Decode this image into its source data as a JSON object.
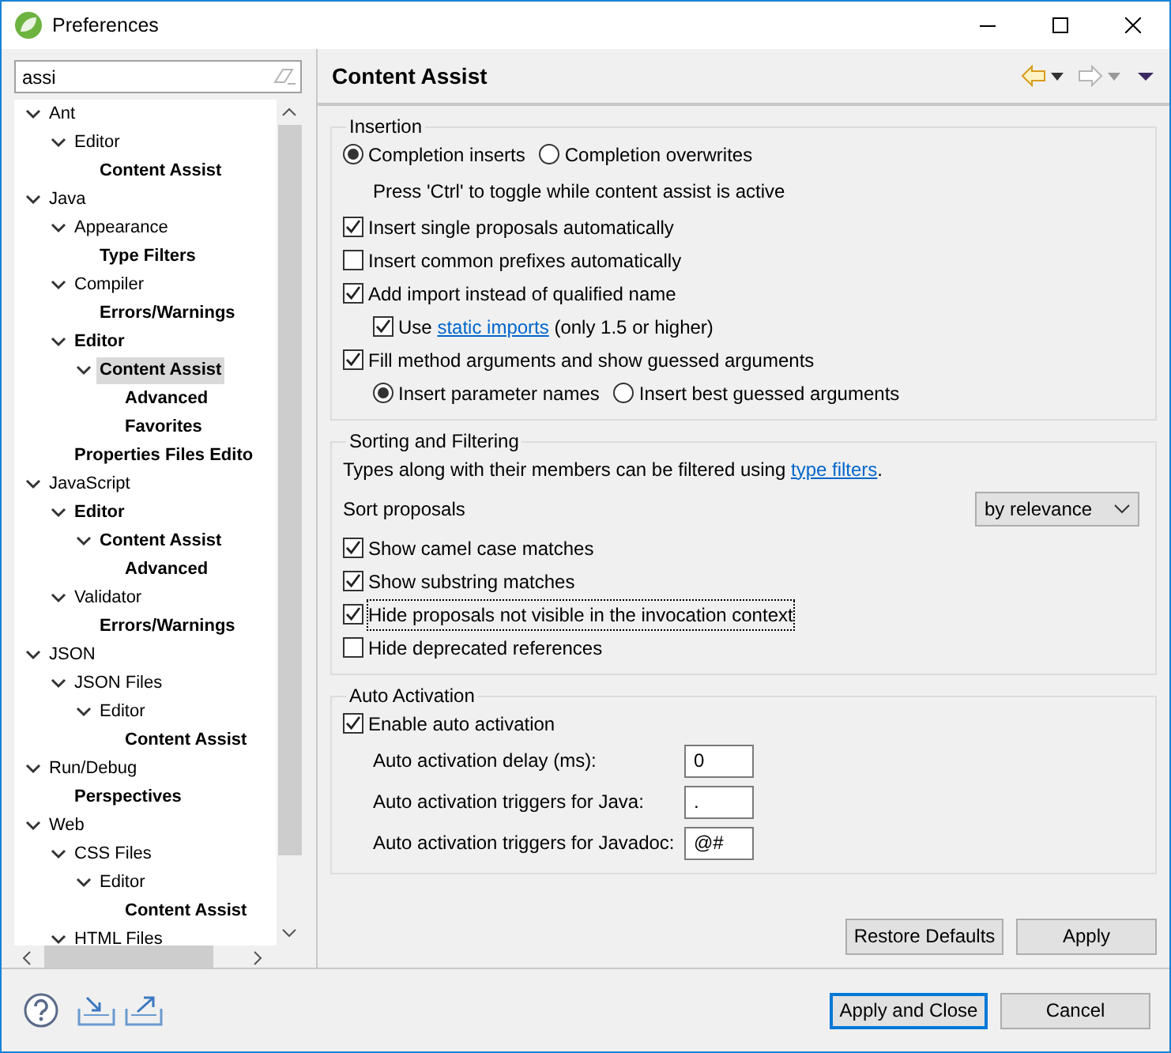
{
  "window": {
    "title": "Preferences"
  },
  "filter": {
    "value": "assi"
  },
  "tree": [
    {
      "label": "Ant",
      "bold": false,
      "expanded": true,
      "selected": false,
      "children": [
        {
          "label": "Editor",
          "bold": false,
          "expanded": true,
          "selected": false,
          "children": [
            {
              "label": "Content Assist",
              "bold": true,
              "selected": false
            }
          ]
        }
      ]
    },
    {
      "label": "Java",
      "bold": false,
      "expanded": true,
      "selected": false,
      "children": [
        {
          "label": "Appearance",
          "bold": false,
          "expanded": true,
          "selected": false,
          "children": [
            {
              "label": "Type Filters",
              "bold": true,
              "selected": false
            }
          ]
        },
        {
          "label": "Compiler",
          "bold": false,
          "expanded": true,
          "selected": false,
          "children": [
            {
              "label": "Errors/Warnings",
              "bold": true,
              "selected": false
            }
          ]
        },
        {
          "label": "Editor",
          "bold": true,
          "expanded": true,
          "selected": false,
          "children": [
            {
              "label": "Content Assist",
              "bold": true,
              "expanded": true,
              "selected": true,
              "children": [
                {
                  "label": "Advanced",
                  "bold": true,
                  "selected": false
                },
                {
                  "label": "Favorites",
                  "bold": true,
                  "selected": false
                }
              ]
            }
          ]
        },
        {
          "label": "Properties Files Edito",
          "bold": true,
          "selected": false
        }
      ]
    },
    {
      "label": "JavaScript",
      "bold": false,
      "expanded": true,
      "selected": false,
      "children": [
        {
          "label": "Editor",
          "bold": true,
          "expanded": true,
          "selected": false,
          "children": [
            {
              "label": "Content Assist",
              "bold": true,
              "expanded": true,
              "selected": false,
              "children": [
                {
                  "label": "Advanced",
                  "bold": true,
                  "selected": false
                }
              ]
            }
          ]
        },
        {
          "label": "Validator",
          "bold": false,
          "expanded": true,
          "selected": false,
          "children": [
            {
              "label": "Errors/Warnings",
              "bold": true,
              "selected": false
            }
          ]
        }
      ]
    },
    {
      "label": "JSON",
      "bold": false,
      "expanded": true,
      "selected": false,
      "children": [
        {
          "label": "JSON Files",
          "bold": false,
          "expanded": true,
          "selected": false,
          "children": [
            {
              "label": "Editor",
              "bold": false,
              "expanded": true,
              "selected": false,
              "children": [
                {
                  "label": "Content Assist",
                  "bold": true,
                  "selected": false
                }
              ]
            }
          ]
        }
      ]
    },
    {
      "label": "Run/Debug",
      "bold": false,
      "expanded": true,
      "selected": false,
      "children": [
        {
          "label": "Perspectives",
          "bold": true,
          "selected": false
        }
      ]
    },
    {
      "label": "Web",
      "bold": false,
      "expanded": true,
      "selected": false,
      "children": [
        {
          "label": "CSS Files",
          "bold": false,
          "expanded": true,
          "selected": false,
          "children": [
            {
              "label": "Editor",
              "bold": false,
              "expanded": true,
              "selected": false,
              "children": [
                {
                  "label": "Content Assist",
                  "bold": true,
                  "selected": false
                }
              ]
            }
          ]
        },
        {
          "label": "HTML Files",
          "bold": false,
          "expanded": true,
          "selected": false
        }
      ]
    }
  ],
  "page": {
    "title": "Content Assist"
  },
  "groups": [
    {
      "title": "Insertion",
      "items": [
        {
          "kind": "radios",
          "options": [
            {
              "label": "Completion inserts",
              "selected": true
            },
            {
              "label": "Completion overwrites",
              "selected": false
            }
          ]
        },
        {
          "kind": "note",
          "text": "Press 'Ctrl' to toggle while content assist is active"
        },
        {
          "kind": "checkbox",
          "label": "Insert single proposals automatically",
          "checked": true
        },
        {
          "kind": "checkbox",
          "label": "Insert common prefixes automatically",
          "checked": false
        },
        {
          "kind": "checkbox",
          "label": "Add import instead of qualified name",
          "checked": true,
          "children": [
            {
              "kind": "checkbox",
              "label": "Use",
              "link": "static imports",
              "after": "(only 1.5 or higher)",
              "checked": true
            }
          ]
        },
        {
          "kind": "checkbox",
          "label": "Fill method arguments and show guessed arguments",
          "checked": true,
          "children": [
            {
              "kind": "radios",
              "options": [
                {
                  "label": "Insert parameter names",
                  "selected": true
                },
                {
                  "label": "Insert best guessed arguments",
                  "selected": false
                }
              ]
            }
          ]
        }
      ]
    },
    {
      "title": "Sorting and Filtering",
      "items": [
        {
          "kind": "sentence",
          "text": "Types along with their members can be filtered using",
          "link": "type filters",
          "after": "."
        },
        {
          "kind": "select",
          "label": "Sort proposals",
          "value": "by relevance"
        },
        {
          "kind": "checkbox",
          "label": "Show camel case matches",
          "checked": true
        },
        {
          "kind": "checkbox",
          "label": "Show substring matches",
          "checked": true
        },
        {
          "kind": "checkbox",
          "label": "Hide proposals not visible in the invocation context",
          "checked": true,
          "focused": true
        },
        {
          "kind": "checkbox",
          "label": "Hide deprecated references",
          "checked": false
        }
      ]
    },
    {
      "title": "Auto Activation",
      "items": [
        {
          "kind": "checkbox",
          "label": "Enable auto activation",
          "checked": true
        },
        {
          "kind": "field",
          "label": "Auto activation delay (ms):",
          "value": "0"
        },
        {
          "kind": "field",
          "label": "Auto activation triggers for Java:",
          "value": "."
        },
        {
          "kind": "field",
          "label": "Auto activation triggers for Javadoc:",
          "value": "@#"
        }
      ]
    }
  ],
  "page_buttons": [
    {
      "label": "Restore Defaults",
      "default": false
    },
    {
      "label": "Apply",
      "default": false
    }
  ],
  "dialog_buttons": [
    {
      "label": "Apply and Close",
      "default": true
    },
    {
      "label": "Cancel",
      "default": false
    }
  ]
}
